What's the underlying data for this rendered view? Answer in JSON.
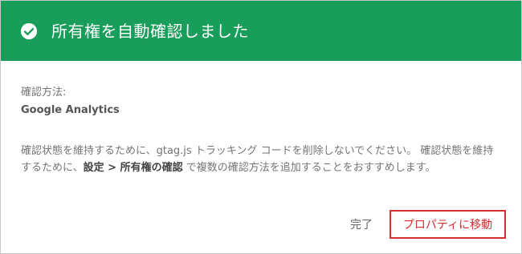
{
  "header": {
    "title": "所有権を自動確認しました",
    "icon": "check-circle-icon",
    "background": "#189d5a"
  },
  "method": {
    "label": "確認方法:",
    "value": "Google Analytics"
  },
  "message": {
    "part1": "確認状態を維持するために、gtag.js トラッキング コードを削除しないでください。 確認状態を維持するために、",
    "settings_path": "設定 > 所有権の確認",
    "part2": " で複数の確認方法を追加することをおすすめします。"
  },
  "buttons": {
    "done": "完了",
    "go_to_property": "プロパティに移動"
  },
  "colors": {
    "highlight_border": "#d32f2f"
  }
}
